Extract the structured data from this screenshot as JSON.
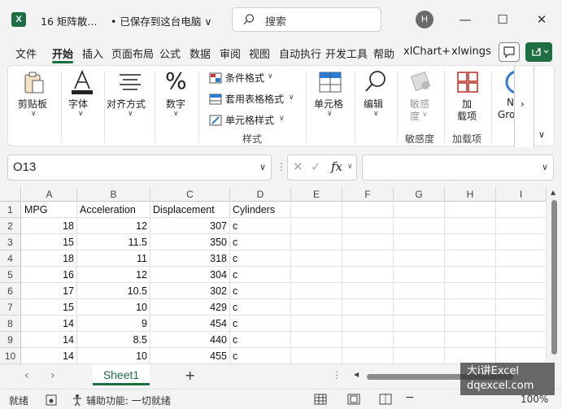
{
  "titlebar": {
    "app_icon": "excel-icon",
    "file_name": "16 矩阵散...",
    "save_status": "• 已保存到这台电脑 ∨",
    "search_placeholder": "搜索",
    "user_initial": "H"
  },
  "tabs": [
    "文件",
    "开始",
    "插入",
    "页面布局",
    "公式",
    "数据",
    "审阅",
    "视图",
    "自动执行",
    "开发工具",
    "帮助",
    "xlChart+",
    "xlwings"
  ],
  "active_tab": "开始",
  "ribbon": {
    "clipboard": "剪贴板",
    "font": "字体",
    "alignment": "对齐方式",
    "number": "数字",
    "conditional_format": "条件格式",
    "table_format": "套用表格格式",
    "cell_style": "单元格样式",
    "styles_group": "样式",
    "cells": "单元格",
    "editing": "编辑",
    "sensitivity_line1": "敏感",
    "sensitivity_line2": "度",
    "sensitivity_group": "敏感度",
    "addins_line1": "加",
    "addins_line2": "载项",
    "addins_group": "加载项",
    "new_group_line1": "N",
    "new_group_line2": "Gro"
  },
  "formula_bar": {
    "name_box": "O13",
    "fx_label": "fx",
    "formula": ""
  },
  "grid": {
    "columns": [
      "A",
      "B",
      "C",
      "D",
      "E",
      "F",
      "G",
      "H",
      "I"
    ],
    "rows": [
      [
        "1",
        "MPG",
        "Acceleration",
        "Displacement",
        "Cylinders"
      ],
      [
        "2",
        "18",
        "12",
        "307",
        "c"
      ],
      [
        "3",
        "15",
        "11.5",
        "350",
        "c"
      ],
      [
        "4",
        "18",
        "11",
        "318",
        "c"
      ],
      [
        "5",
        "16",
        "12",
        "304",
        "c"
      ],
      [
        "6",
        "17",
        "10.5",
        "302",
        "c"
      ],
      [
        "7",
        "15",
        "10",
        "429",
        "c"
      ],
      [
        "8",
        "14",
        "9",
        "454",
        "c"
      ],
      [
        "9",
        "14",
        "8.5",
        "440",
        "c"
      ],
      [
        "10",
        "14",
        "10",
        "455",
        "c"
      ]
    ]
  },
  "sheets": {
    "active": "Sheet1",
    "add_label": "+"
  },
  "status": {
    "ready": "就绪",
    "accessibility": "辅助功能: 一切就绪",
    "zoom": "100%"
  },
  "watermark": {
    "line1": "大i讲Excel",
    "line2": "dqexcel.com"
  },
  "colors": {
    "accent": "#1d6f42"
  }
}
